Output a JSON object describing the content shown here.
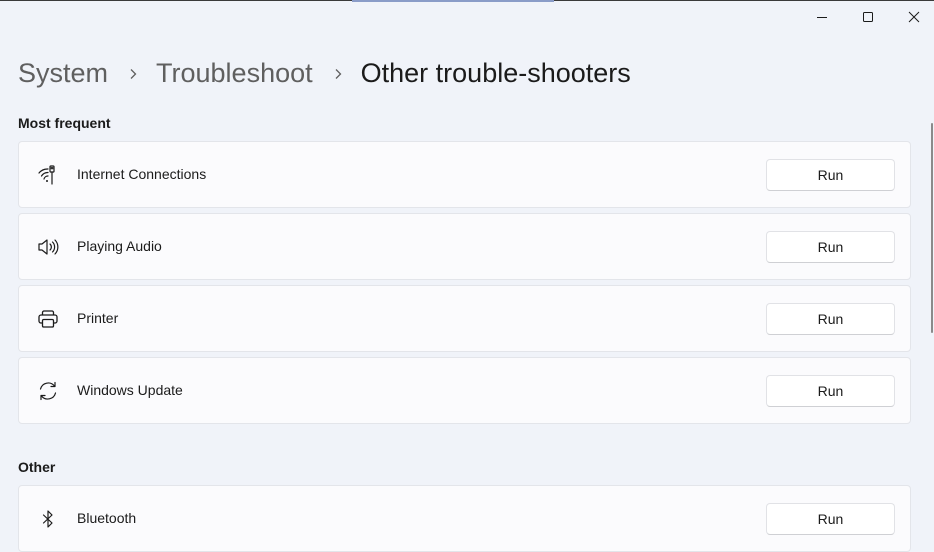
{
  "window": {
    "controls": {
      "minimize": "minimize",
      "maximize": "maximize",
      "close": "close"
    }
  },
  "breadcrumb": {
    "items": [
      "System",
      "Troubleshoot",
      "Other trouble-shooters"
    ]
  },
  "sections": [
    {
      "title": "Most frequent",
      "items": [
        {
          "label": "Internet Connections",
          "icon": "wifi-ethernet-icon",
          "button": "Run"
        },
        {
          "label": "Playing Audio",
          "icon": "speaker-icon",
          "button": "Run"
        },
        {
          "label": "Printer",
          "icon": "printer-icon",
          "button": "Run"
        },
        {
          "label": "Windows Update",
          "icon": "sync-icon",
          "button": "Run"
        }
      ]
    },
    {
      "title": "Other",
      "items": [
        {
          "label": "Bluetooth",
          "icon": "bluetooth-icon",
          "button": "Run"
        }
      ]
    }
  ]
}
